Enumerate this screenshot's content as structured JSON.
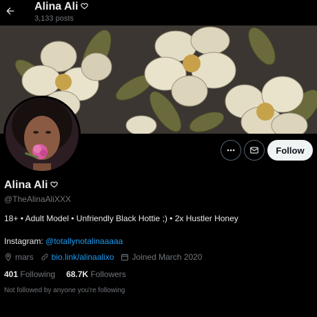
{
  "header": {
    "name": "Alina Ali",
    "posts": "3,133 posts"
  },
  "actions": {
    "follow_label": "Follow"
  },
  "profile": {
    "name": "Alina Ali",
    "handle": "@TheAlinaAliXXX",
    "bio": "18+ • Adult Model • Unfriendly Black Hottie ;) • 2x Hustler Honey",
    "instagram_label": "Instagram: ",
    "instagram_handle": "@totallynotalinaaaaa",
    "location": "mars",
    "website": "bio.link/alinaalixo",
    "joined": "Joined March 2020",
    "following_count": "401",
    "following_label": "Following",
    "followers_count": "68.7K",
    "followers_label": "Followers",
    "not_followed": "Not followed by anyone you're following"
  },
  "colors": {
    "accent": "#1d9bf0",
    "background": "#000000",
    "muted": "#71767b"
  }
}
